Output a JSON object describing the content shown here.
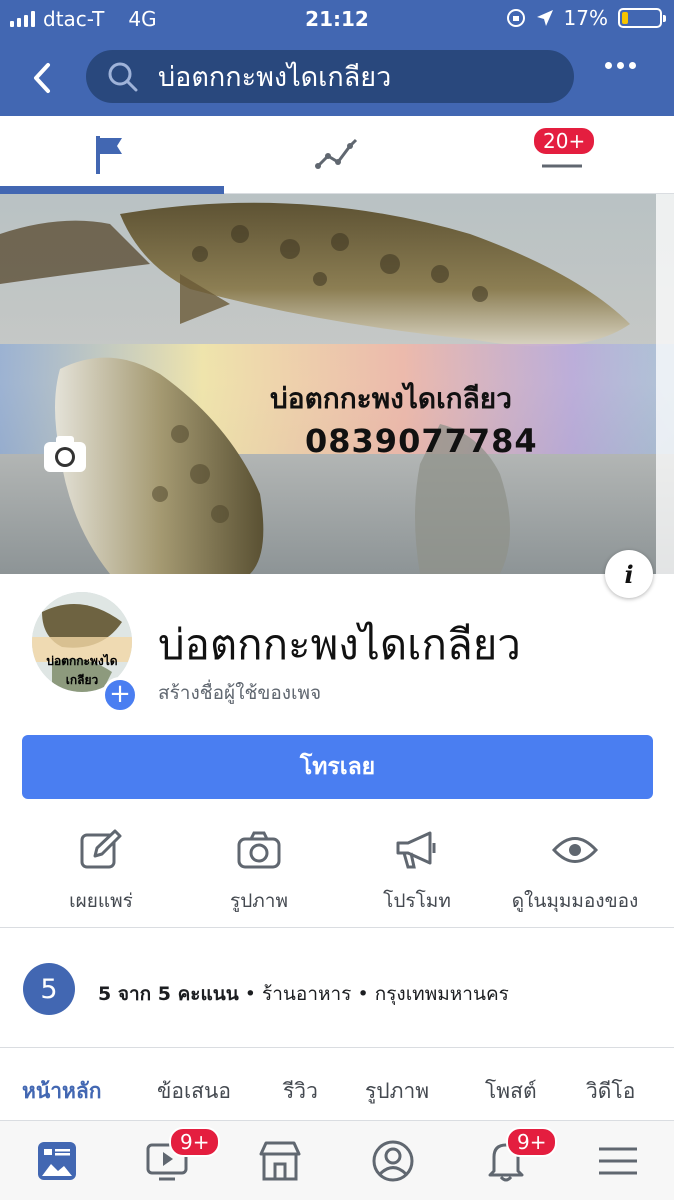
{
  "status_bar": {
    "carrier": "dtac-T",
    "network": "4G",
    "time": "21:12",
    "battery_percent": "17%",
    "battery_level": 0.17
  },
  "search": {
    "query": "บ่อตกกะพงไดเกลียว"
  },
  "top_tabs": [
    {
      "icon": "flag-icon",
      "active": true
    },
    {
      "icon": "activity-icon",
      "active": false
    },
    {
      "icon": "menu-icon",
      "active": false,
      "badge": "20+"
    }
  ],
  "cover": {
    "title": "บ่อตกกะพงไดเกลียว",
    "phone": "0839077784",
    "info_label": "i"
  },
  "profile": {
    "avatar_text": "บ่อตกกะพงไดเกลียว",
    "name": "บ่อตกกะพงไดเกลียว",
    "subtitle": "สร้างชื่อผู้ใช้ของเพจ",
    "call_button": "โทรเลย"
  },
  "actions": [
    {
      "label": "เผยแพร่",
      "icon": "edit-icon"
    },
    {
      "label": "รูปภาพ",
      "icon": "camera-icon"
    },
    {
      "label": "โปรโมท",
      "icon": "megaphone-icon"
    },
    {
      "label": "ดูในมุมมองของ",
      "icon": "eye-icon"
    }
  ],
  "rating": {
    "score": "5",
    "text": "5 จาก 5 คะแนน",
    "separator": "•",
    "category": "ร้านอาหาร",
    "location": "กรุงเทพมหานคร"
  },
  "section_tabs": [
    "หน้าหลัก",
    "ข้อเสนอ",
    "รีวิว",
    "รูปภาพ",
    "โพสต์",
    "วิดีโอ"
  ],
  "bottom_nav": [
    {
      "icon": "news-feed-icon",
      "active": true
    },
    {
      "icon": "watch-icon",
      "badge": "9+"
    },
    {
      "icon": "marketplace-icon"
    },
    {
      "icon": "profile-icon"
    },
    {
      "icon": "notifications-icon",
      "badge": "9+"
    },
    {
      "icon": "menu-icon"
    }
  ],
  "colors": {
    "brand": "#4267b2",
    "button": "#4a7ef1",
    "badge": "#e41e3f",
    "battery": "#f5c400"
  }
}
